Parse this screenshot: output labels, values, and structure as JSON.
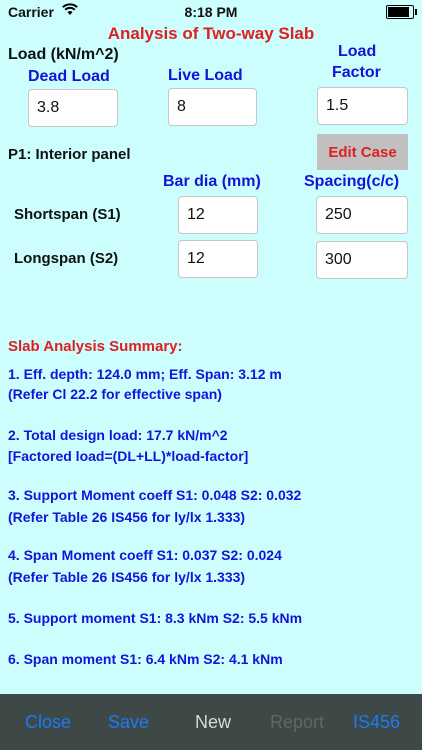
{
  "status": {
    "carrier": "Carrier",
    "time": "8:18 PM"
  },
  "title": "Analysis of Two-way Slab",
  "load": {
    "heading": "Load (kN/m^2)",
    "dead_label": "Dead Load",
    "live_label": "Live Load",
    "factor_label_1": "Load",
    "factor_label_2": "Factor",
    "dead_value": "3.8",
    "live_value": "8",
    "factor_value": "1.5"
  },
  "panel": {
    "label": "P1: Interior panel",
    "edit_case": "Edit Case",
    "bar_dia_label": "Bar dia (mm)",
    "spacing_label": "Spacing(c/c)",
    "shortspan_label": "Shortspan (S1)",
    "longspan_label": "Longspan (S2)",
    "short_bar": "12",
    "short_spacing": "250",
    "long_bar": "12",
    "long_spacing": "300"
  },
  "summary": {
    "heading": "Slab Analysis Summary:",
    "lines": [
      "1. Eff. depth: 124.0 mm; Eff. Span: 3.12 m",
      "(Refer Cl 22.2 for effective span)",
      "2. Total design load: 17.7 kN/m^2",
      "[Factored load=(DL+LL)*load-factor]",
      "3. Support Moment coeff S1: 0.048  S2: 0.032",
      "(Refer Table 26 IS456 for ly/lx 1.333)",
      "4. Span Moment coeff S1: 0.037  S2: 0.024",
      "(Refer Table 26 IS456 for ly/lx 1.333)",
      "5. Support moment S1: 8.3 kNm  S2: 5.5 kNm",
      "6. Span moment S1: 6.4 kNm  S2: 4.1 kNm"
    ]
  },
  "toolbar": {
    "close": "Close",
    "save": "Save",
    "new": "New",
    "report": "Report",
    "is456": "IS456"
  },
  "colors": {
    "background": "#ccfefe",
    "accent_red": "#e02020",
    "accent_blue": "#1414d8",
    "toolbar": "#3e4846",
    "toolbar_link": "#1a7cf5"
  }
}
